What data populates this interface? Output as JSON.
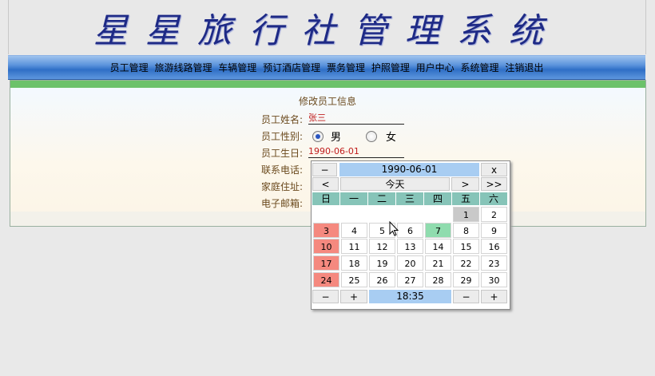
{
  "app_title": "星星旅行社管理系统",
  "nav": [
    "员工管理",
    "旅游线路管理",
    "车辆管理",
    "预订酒店管理",
    "票务管理",
    "护照管理",
    "用户中心",
    "系统管理",
    "注销退出"
  ],
  "form": {
    "title": "修改员工信息",
    "labels": {
      "name": "员工姓名:",
      "gender": "员工性别:",
      "birthday": "员工生日:",
      "phone": "联系电话:",
      "address": "家庭住址:",
      "email": "电子邮箱:"
    },
    "name_value": "张三",
    "gender_options": [
      "男",
      "女"
    ],
    "gender_selected": "男",
    "birthday_value": "1990-06-01"
  },
  "calendar": {
    "nav": {
      "prev_year": "−",
      "next_year": "x",
      "prev_month": "<",
      "today": "今天",
      "next_month": ">",
      "next_next": ">>"
    },
    "display_date": "1990-06-01",
    "weekdays": [
      "日",
      "一",
      "二",
      "三",
      "四",
      "五",
      "六"
    ],
    "rows": [
      [
        "",
        "",
        "",
        "",
        "",
        "1",
        "2"
      ],
      [
        "3",
        "4",
        "5",
        "6",
        "7",
        "8",
        "9"
      ],
      [
        "10",
        "11",
        "12",
        "13",
        "14",
        "15",
        "16"
      ],
      [
        "17",
        "18",
        "19",
        "20",
        "21",
        "22",
        "23"
      ],
      [
        "24",
        "25",
        "26",
        "27",
        "28",
        "29",
        "30"
      ]
    ],
    "selected_day": "1",
    "today_day": "7",
    "time": {
      "minus_hour": "−",
      "plus_hour": "+",
      "value": "18:35",
      "minus_min": "−",
      "plus_min": "+"
    }
  }
}
